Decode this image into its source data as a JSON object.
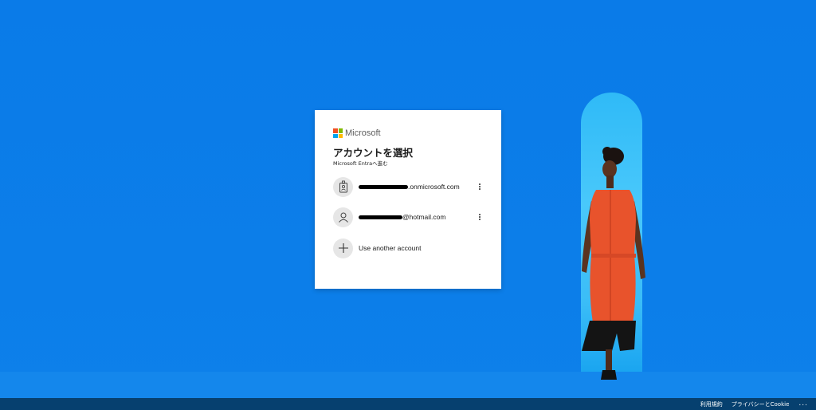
{
  "brand": {
    "name": "Microsoft"
  },
  "card": {
    "title": "アカウントを選択",
    "subtitle": "Microsoft Entraへ進む"
  },
  "accounts": [
    {
      "email_suffix": ".onmicrosoft.com",
      "icon": "badge-icon"
    },
    {
      "email_suffix": "@hotmail.com",
      "icon": "person-icon"
    }
  ],
  "add_account": {
    "label": "Use another account",
    "icon": "plus-icon"
  },
  "footer": {
    "terms": "利用規約",
    "privacy": "プライバシーとCookie",
    "more": "..."
  },
  "colors": {
    "background": "#0a7ae6",
    "footer": "#06406f",
    "card": "#ffffff",
    "ms_red": "#f25022",
    "ms_green": "#7fba00",
    "ms_blue": "#00a4ef",
    "ms_yellow": "#ffb900"
  }
}
